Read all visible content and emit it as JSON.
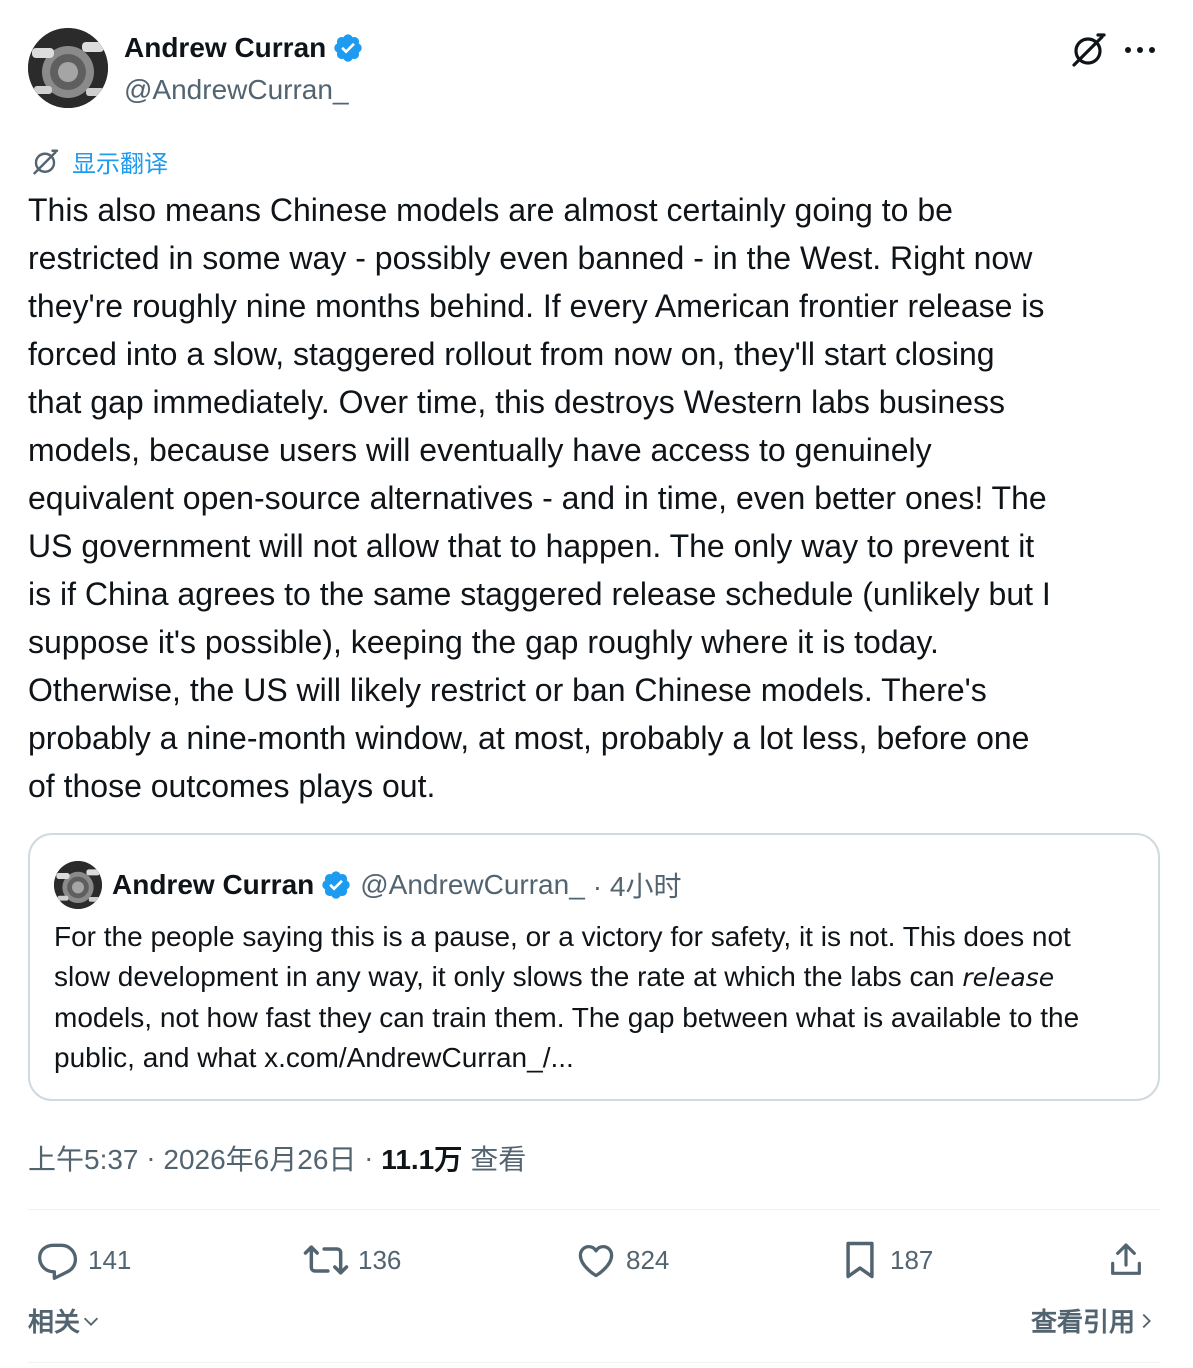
{
  "author": {
    "name": "Andrew Curran",
    "handle": "@AndrewCurran_"
  },
  "translate_label": "显示翻译",
  "tweet_text": "This also means Chinese models are almost certainly going to be\nrestricted in some way - possibly even banned - in the West. Right now\nthey're roughly nine months behind. If every American frontier release is\nforced into a slow, staggered rollout from now on, they'll start closing\nthat gap immediately. Over time, this destroys Western labs business\nmodels, because users will eventually have access to genuinely\nequivalent open-source alternatives - and in time, even better ones! The\nUS government will not allow that to happen. The only way to prevent it\nis if China agrees to the same staggered release schedule (unlikely but I\nsuppose it's possible), keeping the gap roughly where it is today.\nOtherwise, the US will likely restrict or ban Chinese models. There's\nprobably a nine-month window, at most, probably a lot less, before one\nof those outcomes plays out.",
  "quote": {
    "name": "Andrew Curran",
    "handle": "@AndrewCurran_",
    "time": "· 4小时",
    "text_before": "For the people saying this is a pause, or a victory for safety, it is not. This does not slow development in any way, it only slows the rate at which the labs can ",
    "text_emphasis": "release",
    "text_after": " models, not how fast they can train them. The gap between what is available to the public, and what x.com/AndrewCurran_/..."
  },
  "meta": {
    "time": "上午5:37",
    "sep1": " · ",
    "date": "2026年6月26日",
    "sep2": " · ",
    "views_count": "11.1万",
    "views_label": "查看"
  },
  "actions": {
    "replies": "141",
    "reposts": "136",
    "likes": "824",
    "bookmarks": "187"
  },
  "footer": {
    "related": "相关",
    "view_quotes": "查看引用"
  },
  "colors": {
    "accent": "#1d9bf0",
    "text": "#0f1419",
    "secondary": "#536471",
    "border": "#cfd9de"
  }
}
